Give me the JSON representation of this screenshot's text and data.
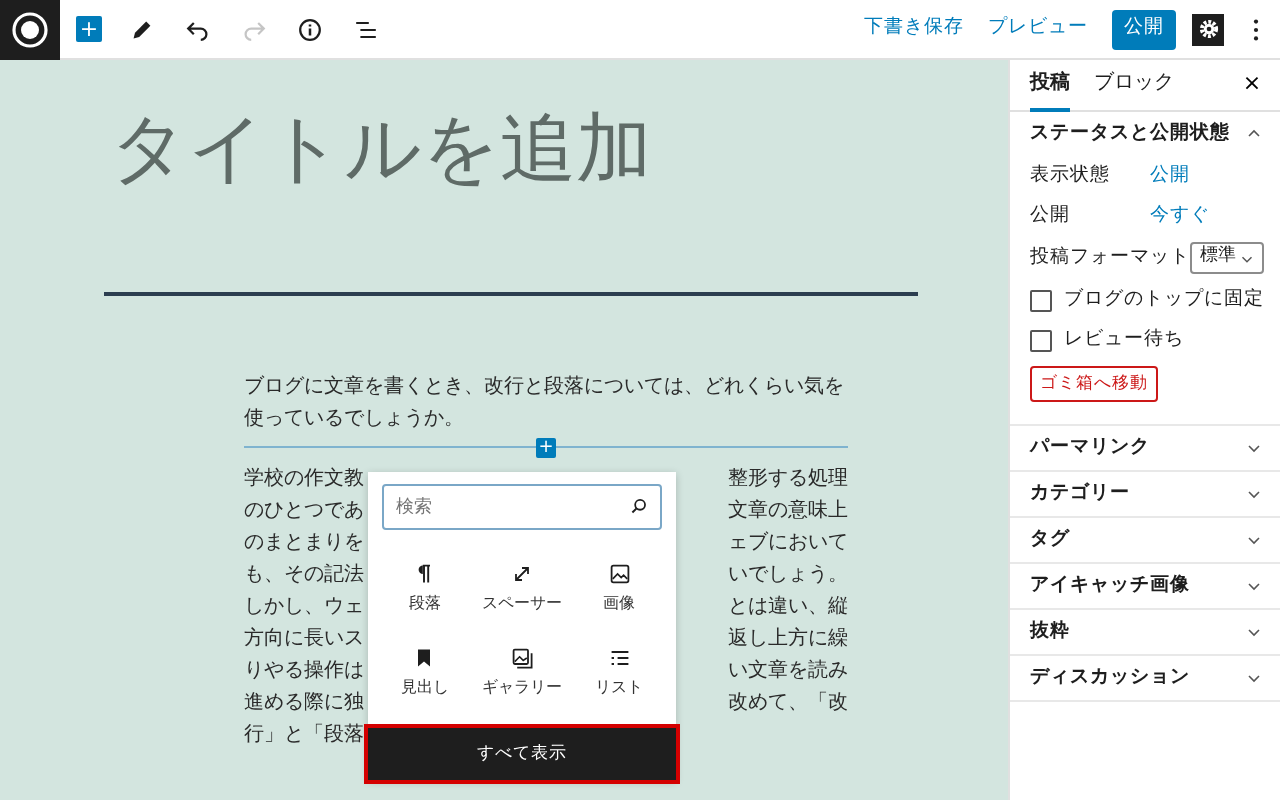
{
  "toolbar": {
    "add": "+",
    "tools": [
      {
        "disabled": false
      },
      {
        "disabled": false
      },
      {
        "disabled": true
      },
      {
        "disabled": false
      },
      {
        "disabled": false
      }
    ],
    "actions": [
      "下書き保存",
      "プレビュー"
    ],
    "publish": "公開",
    "settings_on": true
  },
  "editor": {
    "title_placeholder": "タイトルを追加",
    "paragraph": "ブログに文章を書くとき、改行と段落については、どれくらい気を使っているでしょうか。",
    "inserter_plus": "+",
    "covered_lines": [
      {
        "left": "学校の作文教",
        "right": "整形する処理"
      },
      {
        "left": "のひとつであ",
        "right": "文章の意味上"
      },
      {
        "left": "のまとまりを",
        "right": "ェブにおいて"
      },
      {
        "left": "も、その記法",
        "right": "いでしょう。"
      },
      {
        "left": "しかし、ウェ",
        "right": "とは違い、縦"
      },
      {
        "left": "方向に長いス",
        "right": "返し上方に繰"
      },
      {
        "left": "りやる操作は",
        "right": "い文章を読み"
      },
      {
        "left": "進める際に独",
        "right": "改めて、「改"
      },
      {
        "left": "行」と「段落"
      }
    ]
  },
  "inserter": {
    "search_placeholder": "検索",
    "blocks": [
      {
        "label": "段落"
      },
      {
        "label": "スペーサー"
      },
      {
        "label": "画像"
      },
      {
        "label": "見出し"
      },
      {
        "label": "ギャラリー"
      },
      {
        "label": "リスト"
      }
    ],
    "browse_all": "すべて表示",
    "highlighted": true
  },
  "sidebar": {
    "tabs": [
      {
        "label": "投稿",
        "selected": true
      },
      {
        "label": "ブロック",
        "selected": false
      }
    ],
    "close": "×",
    "sections": [
      {
        "title": "ステータスと公開状態",
        "expanded": true,
        "rows": [
          {
            "kind": "link",
            "label": "表示状態",
            "value": "公開"
          },
          {
            "kind": "link",
            "label": "公開",
            "value": "今すぐ"
          },
          {
            "kind": "select",
            "label": "投稿フォーマット",
            "value": "標準"
          },
          {
            "kind": "checkbox",
            "label": "ブログのトップに固定",
            "checked": false
          },
          {
            "kind": "checkbox",
            "label": "レビュー待ち",
            "checked": false
          },
          {
            "kind": "button",
            "label": "ゴミ箱へ移動"
          }
        ]
      },
      {
        "title": "パーマリンク",
        "expanded": false
      },
      {
        "title": "カテゴリー",
        "expanded": false
      },
      {
        "title": "タグ",
        "expanded": false
      },
      {
        "title": "アイキャッチ画像",
        "expanded": false
      },
      {
        "title": "抜粋",
        "expanded": false
      },
      {
        "title": "ディスカッション",
        "expanded": false
      }
    ]
  }
}
